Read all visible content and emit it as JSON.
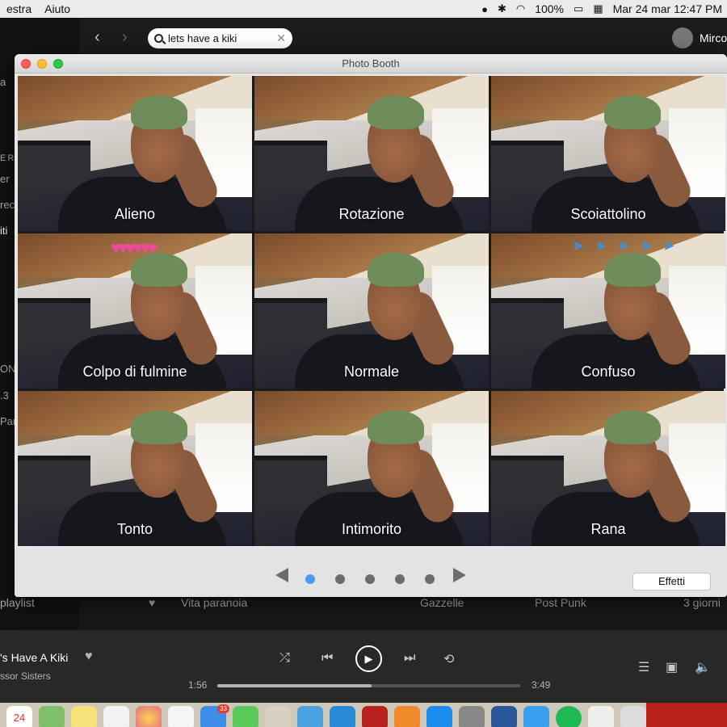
{
  "menubar": {
    "left_items": [
      "estra",
      "Aiuto"
    ],
    "battery": "100%",
    "datetime": "Mar 24 mar  12:47 PM",
    "user": "Mirco"
  },
  "spotify": {
    "search_value": "lets have a kiki",
    "sidebar_fragments": [
      "a",
      "ER",
      "er",
      "rec",
      "iti",
      "ON",
      ".3",
      "Par",
      "playlist"
    ],
    "track_row": {
      "title": "Vita paranoia",
      "artist": "Gazzelle",
      "album": "Post Punk",
      "added": "3 giorni"
    },
    "now_playing": {
      "title": "'s Have A Kiki",
      "artist": "ssor Sisters",
      "elapsed": "1:56",
      "duration": "3:49",
      "progress": 0.51
    }
  },
  "photobooth": {
    "window_title": "Photo Booth",
    "effects": [
      {
        "label": "Alieno"
      },
      {
        "label": "Rotazione"
      },
      {
        "label": "Scoiattolino"
      },
      {
        "label": "Colpo di fulmine"
      },
      {
        "label": "Normale"
      },
      {
        "label": "Confuso"
      },
      {
        "label": "Tonto"
      },
      {
        "label": "Intimorito"
      },
      {
        "label": "Rana"
      }
    ],
    "pages": 5,
    "active_page": 1,
    "effects_button": "Effetti"
  },
  "dock": {
    "calendar_day": "24",
    "mail_badge": "33"
  },
  "colors": {
    "accent_blue": "#4c9bf2",
    "spotify_dark": "#181818",
    "spotify_green": "#1db954"
  }
}
